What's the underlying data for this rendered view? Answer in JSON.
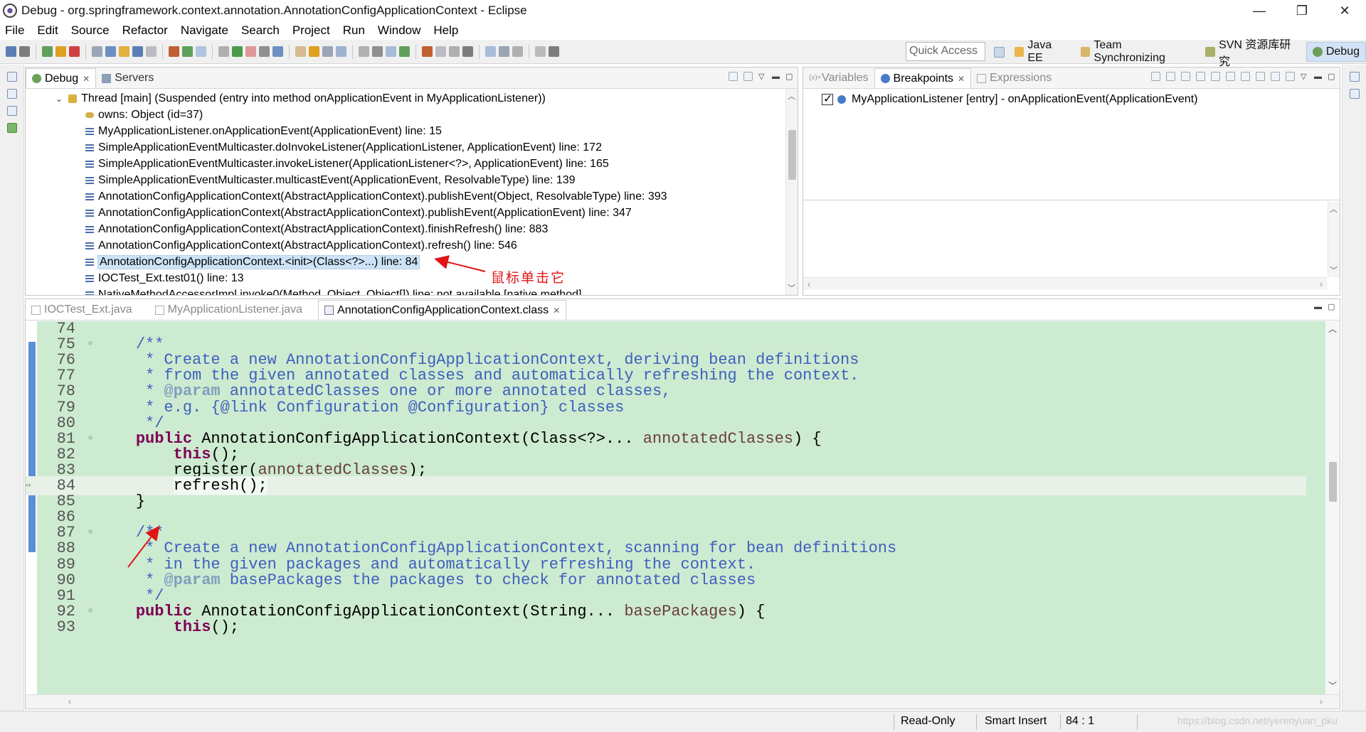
{
  "window": {
    "title": "Debug - org.springframework.context.annotation.AnnotationConfigApplicationContext - Eclipse",
    "minimize": "—",
    "maximize": "❐",
    "close": "✕"
  },
  "menu": [
    "File",
    "Edit",
    "Source",
    "Refactor",
    "Navigate",
    "Search",
    "Project",
    "Run",
    "Window",
    "Help"
  ],
  "toolbar": {
    "quick_access_placeholder": "Quick Access",
    "perspectives": [
      {
        "label": "Java EE",
        "icon": "java-ee-icon",
        "active": false
      },
      {
        "label": "Team Synchronizing",
        "icon": "team-sync-icon",
        "active": false
      },
      {
        "label": "SVN 资源库研究",
        "icon": "svn-icon",
        "active": false
      },
      {
        "label": "Debug",
        "icon": "debug-icon",
        "active": true
      }
    ]
  },
  "debug_view": {
    "tabs": [
      {
        "label": "Debug",
        "active": true
      },
      {
        "label": "Servers",
        "active": false
      }
    ],
    "thread": "Thread [main] (Suspended (entry into method onApplicationEvent in MyApplicationListener))",
    "owns": "owns: Object  (id=37)",
    "frames": [
      "MyApplicationListener.onApplicationEvent(ApplicationEvent) line: 15",
      "SimpleApplicationEventMulticaster.doInvokeListener(ApplicationListener, ApplicationEvent) line: 172",
      "SimpleApplicationEventMulticaster.invokeListener(ApplicationListener<?>, ApplicationEvent) line: 165",
      "SimpleApplicationEventMulticaster.multicastEvent(ApplicationEvent, ResolvableType) line: 139",
      "AnnotationConfigApplicationContext(AbstractApplicationContext).publishEvent(Object, ResolvableType) line: 393",
      "AnnotationConfigApplicationContext(AbstractApplicationContext).publishEvent(ApplicationEvent) line: 347",
      "AnnotationConfigApplicationContext(AbstractApplicationContext).finishRefresh() line: 883",
      "AnnotationConfigApplicationContext(AbstractApplicationContext).refresh() line: 546",
      "AnnotationConfigApplicationContext.<init>(Class<?>...) line: 84",
      "IOCTest_Ext.test01() line: 13",
      "NativeMethodAccessorImpl.invoke0(Method, Object, Object[]) line: not available [native method]"
    ],
    "selected_index": 8
  },
  "breakpoints_view": {
    "tabs": [
      {
        "label": "Variables",
        "active": false
      },
      {
        "label": "Breakpoints",
        "active": true
      },
      {
        "label": "Expressions",
        "active": false
      }
    ],
    "items": [
      {
        "label": "MyApplicationListener [entry] - onApplicationEvent(ApplicationEvent)",
        "checked": true
      }
    ]
  },
  "editor": {
    "tabs": [
      {
        "label": "IOCTest_Ext.java",
        "active": false
      },
      {
        "label": "MyApplicationListener.java",
        "active": false
      },
      {
        "label": "AnnotationConfigApplicationContext.class",
        "active": true
      }
    ],
    "current_line": 84
  },
  "annotation": {
    "text": "鼠标单击它"
  },
  "status": {
    "mode": "Read-Only",
    "insert": "Smart Insert",
    "position": "84 : 1"
  },
  "watermark": "https://blog.csdn.net/yerenyuan_pku",
  "colors": {
    "editor_bg": "#cdebd0",
    "keyword": "#7f0055",
    "comment": "#3f5fbf",
    "annotation_red": "#e01515",
    "selection": "#cde3f7"
  }
}
